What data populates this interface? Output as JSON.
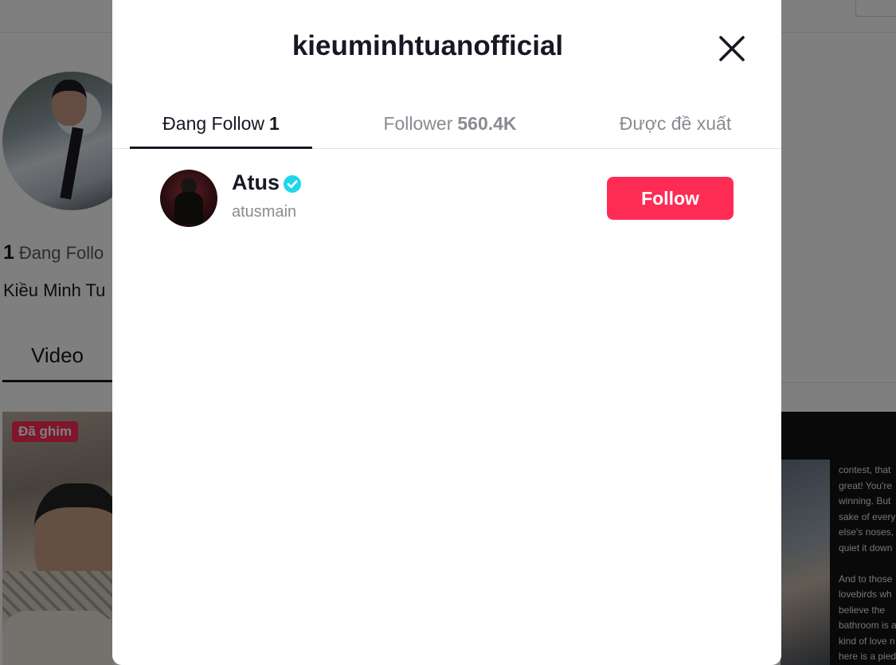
{
  "background": {
    "profile": {
      "following_count": "1",
      "following_label": "Đang Follo",
      "display_name_partial": "Kiều Minh Tu"
    },
    "tabs": {
      "video_label": "Video"
    },
    "pinned_badge": "Đã ghim",
    "right_thumbnail_text": "contest, that\ngreat! You're\nwinning. But\nsake of every\nelse's noses,\nquiet it down\n\nAnd to those\nlovebirds wh\nbelieve the\nbathroom is a\nkind of love n\nhere is a pied"
  },
  "modal": {
    "title": "kieuminhtuanofficial",
    "tabs": [
      {
        "label": "Đang Follow",
        "count": "1",
        "active": true
      },
      {
        "label": "Follower",
        "count": "560.4K",
        "active": false
      },
      {
        "label": "Được đề xuất",
        "count": "",
        "active": false
      }
    ],
    "users": [
      {
        "name": "Atus",
        "verified": true,
        "handle": "atusmain",
        "button_label": "Follow"
      }
    ]
  },
  "colors": {
    "accent": "#fe2c55",
    "verified": "#20d5ec",
    "text_primary": "#161823",
    "text_secondary": "#8a8b91"
  },
  "icons": {
    "close": "close-icon",
    "verified": "verified-badge-icon"
  }
}
